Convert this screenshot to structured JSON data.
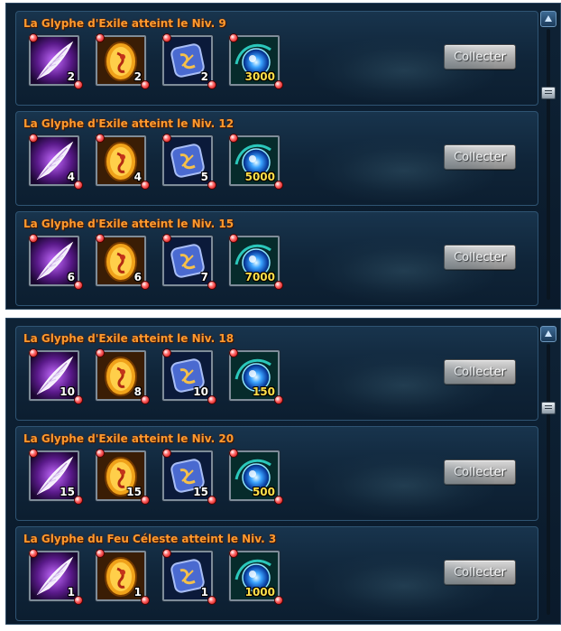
{
  "colors": {
    "title": "#ff9a2e",
    "quantity": "#ffffff",
    "currency_quantity": "#ffe04a",
    "panel_bg": "#0a1a2b",
    "button": "#b4b4b4"
  },
  "panels": [
    {
      "rows": [
        {
          "title": "La Glyphe d'Exile atteint le Niv. 9",
          "button": "Collecter",
          "rewards": [
            {
              "icon": "feather-icon",
              "qty": "2"
            },
            {
              "icon": "amber-egg-icon",
              "qty": "2"
            },
            {
              "icon": "blue-rune-icon",
              "qty": "2"
            },
            {
              "icon": "blue-orb-icon",
              "qty": "3000"
            }
          ]
        },
        {
          "title": "La Glyphe d'Exile atteint le Niv. 12",
          "button": "Collecter",
          "rewards": [
            {
              "icon": "feather-icon",
              "qty": "4"
            },
            {
              "icon": "amber-egg-icon",
              "qty": "4"
            },
            {
              "icon": "blue-rune-icon",
              "qty": "5"
            },
            {
              "icon": "blue-orb-icon",
              "qty": "5000"
            }
          ]
        },
        {
          "title": "La Glyphe d'Exile atteint le Niv. 15",
          "button": "Collecter",
          "rewards": [
            {
              "icon": "feather-icon",
              "qty": "6"
            },
            {
              "icon": "amber-egg-icon",
              "qty": "6"
            },
            {
              "icon": "blue-rune-icon",
              "qty": "7"
            },
            {
              "icon": "blue-orb-icon",
              "qty": "7000"
            }
          ]
        }
      ]
    },
    {
      "rows": [
        {
          "title": "La Glyphe d'Exile atteint le Niv. 18",
          "button": "Collecter",
          "rewards": [
            {
              "icon": "feather-icon",
              "qty": "10"
            },
            {
              "icon": "amber-egg-icon",
              "qty": "8"
            },
            {
              "icon": "blue-rune-icon",
              "qty": "10"
            },
            {
              "icon": "blue-orb-icon",
              "qty": "150"
            }
          ]
        },
        {
          "title": "La Glyphe d'Exile atteint le Niv. 20",
          "button": "Collecter",
          "rewards": [
            {
              "icon": "feather-icon",
              "qty": "15"
            },
            {
              "icon": "amber-egg-icon",
              "qty": "15"
            },
            {
              "icon": "blue-rune-icon",
              "qty": "15"
            },
            {
              "icon": "blue-orb-icon",
              "qty": "500"
            }
          ]
        },
        {
          "title": "La Glyphe du Feu Céleste atteint le Niv. 3",
          "button": "Collecter",
          "rewards": [
            {
              "icon": "feather-icon",
              "qty": "1"
            },
            {
              "icon": "amber-egg-icon",
              "qty": "1"
            },
            {
              "icon": "blue-rune-icon",
              "qty": "1"
            },
            {
              "icon": "blue-orb-icon",
              "qty": "1000"
            }
          ]
        }
      ]
    }
  ]
}
